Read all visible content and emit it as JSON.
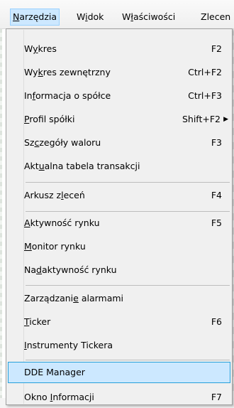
{
  "menubar": {
    "narzedzia": "Narzędzia",
    "widok": "Widok",
    "wlasciwosci": "Właściwości",
    "zlecenia": "Zlecen"
  },
  "menu": {
    "wykres": {
      "label": "Wykres",
      "shortcut": "F2"
    },
    "wykres_zewnetrzny": {
      "label": "Wykres zewnętrzny",
      "shortcut": "Ctrl+F2"
    },
    "informacja_o_spolce": {
      "label": "Informacja o spółce",
      "shortcut": "Ctrl+F3"
    },
    "profil_spolki": {
      "label": "Profil spółki",
      "shortcut": "Shift+F2"
    },
    "szczegoly_waloru": {
      "label": "Szczegóły waloru",
      "shortcut": "F3"
    },
    "aktualna_tabela": {
      "label": "Aktualna tabela transakcji"
    },
    "arkusz_zlecen": {
      "label": "Arkusz zleceń",
      "shortcut": "F4"
    },
    "aktywnosc_rynku": {
      "label": "Aktywność rynku",
      "shortcut": "F5"
    },
    "monitor_rynku": {
      "label": "Monitor rynku"
    },
    "nadaktywnosc_rynku": {
      "label": "Nadaktywność rynku"
    },
    "zarzadzanie_alarmami": {
      "label": "Zarządzanie alarmami"
    },
    "ticker": {
      "label": "Ticker",
      "shortcut": "F6"
    },
    "instrumenty_tickera": {
      "label": "Instrumenty Tickera"
    },
    "dde_manager": {
      "label": "DDE Manager"
    },
    "okno_informacji": {
      "label": "Okno Informacji",
      "shortcut": "F7"
    }
  },
  "submenu_arrow_icon": "submenu-arrow-icon"
}
